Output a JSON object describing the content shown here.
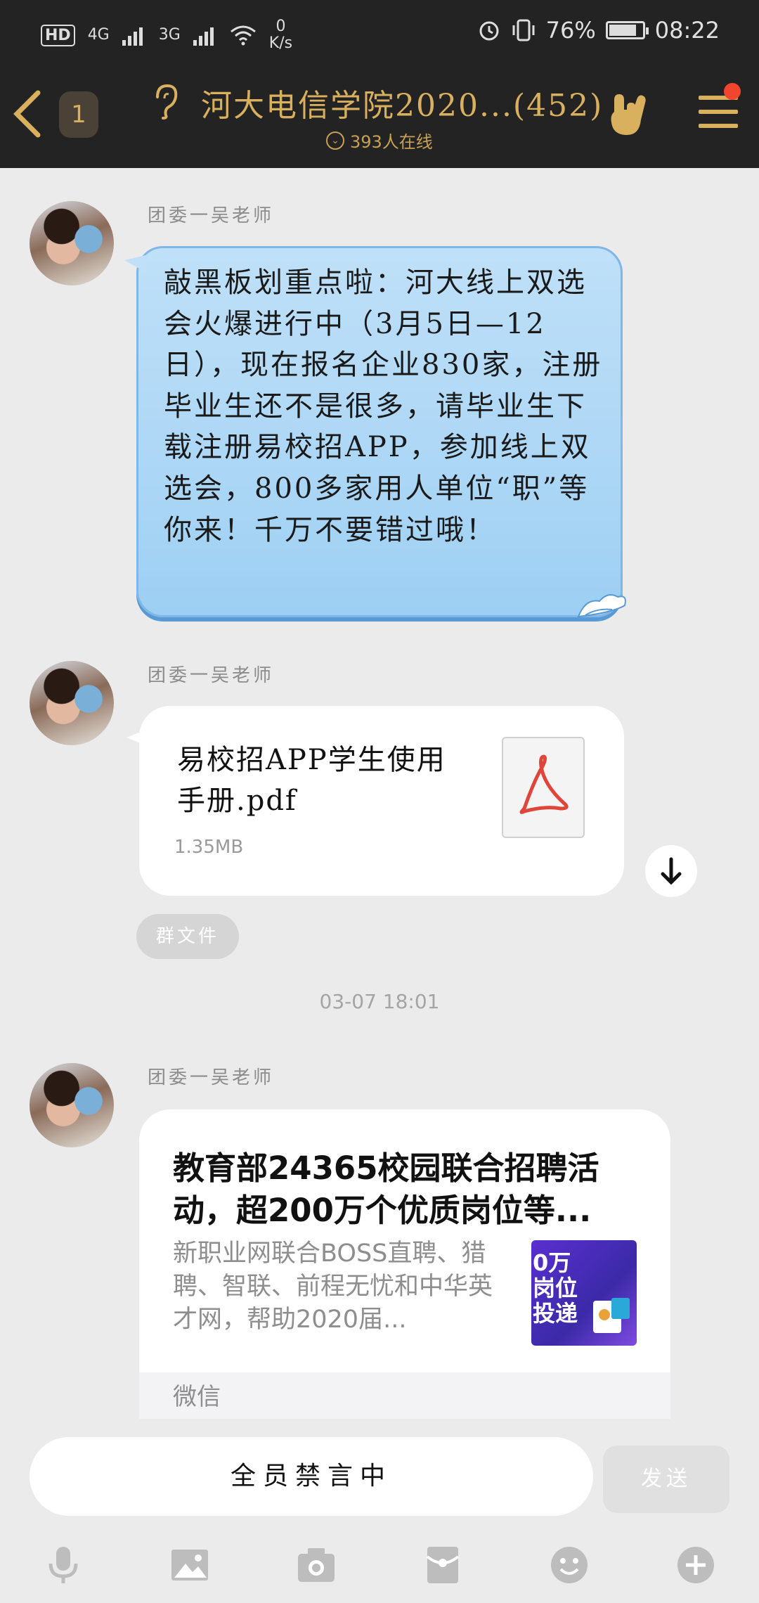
{
  "status": {
    "network": "HD",
    "net_4g": "4G",
    "net_3g": "3G",
    "speed_value": "0",
    "speed_unit": "K/s",
    "battery": "76%",
    "time": "08:22"
  },
  "header": {
    "unread_count": "1",
    "title": "河大电信学院2020...(452)",
    "online": "393人在线",
    "accent_color": "#d9b05e"
  },
  "messages": [
    {
      "sender": "团委一吴老师",
      "text": "敲黑板划重点啦：河大线上双选会火爆进行中（3月5日—12日），现在报名企业830家，注册毕业生还不是很多，请毕业生下载注册易校招APP，参加线上双选会，800多家用人单位“职”等你来！千万不要错过哦！"
    },
    {
      "sender": "团委一吴老师",
      "file_name": "易校招APP学生使用手册.pdf",
      "file_size": "1.35MB",
      "tag": "群文件"
    },
    {
      "sender": "团委一吴老师",
      "link_title": "教育部24365校园联合招聘活动，超200万个优质岗位等...",
      "link_desc": "新职业网联合BOSS直聘、猎聘、智联、前程无忧和中华英才网，帮助2020届...",
      "thumb_text": "0万\n岗位\n投递",
      "source": "微信"
    }
  ],
  "timestamp": "03-07 18:01",
  "input_bar": {
    "placeholder": "全员禁言中",
    "send_label": "发送"
  },
  "toolbar_icons": [
    "microphone-icon",
    "image-icon",
    "camera-icon",
    "red-packet-icon",
    "emoji-icon",
    "plus-icon"
  ]
}
